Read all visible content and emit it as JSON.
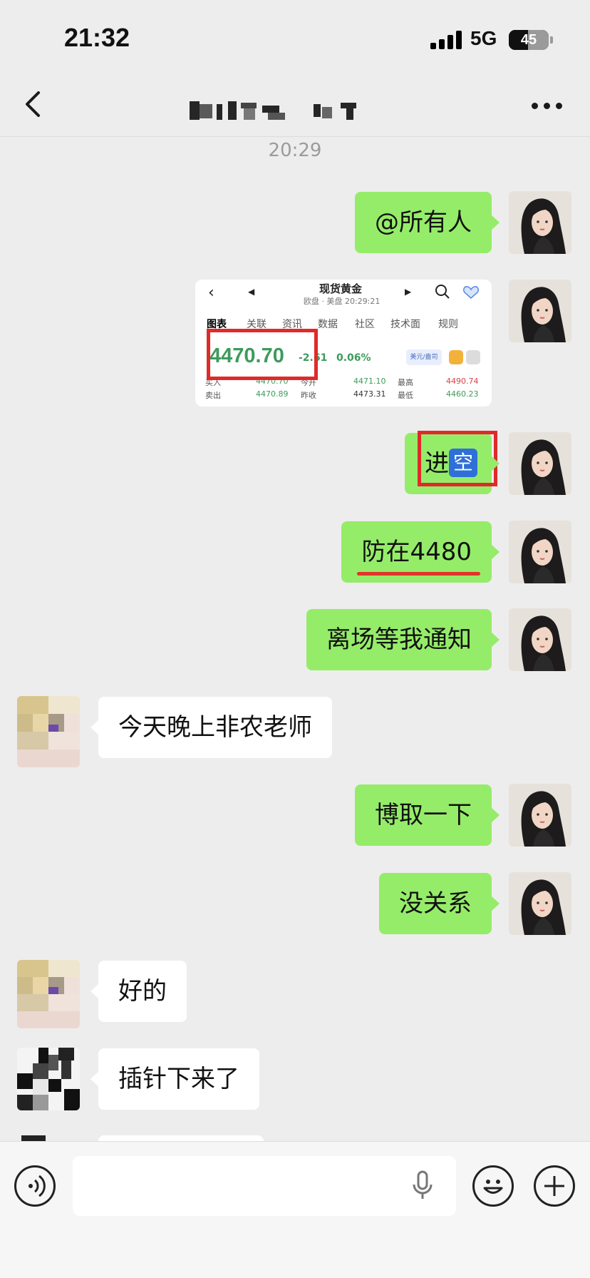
{
  "status": {
    "time": "21:32",
    "network": "5G",
    "battery": "45"
  },
  "chat": {
    "timestamp": "20:29"
  },
  "messages": {
    "m1": "@所有人",
    "m3_prefix": "进",
    "m3_emoji": "空",
    "m4": "防在4480",
    "m5": "离场等我通知",
    "m6": "今天晚上非农老师",
    "m7": "博取一下",
    "m8": "没关系",
    "m9": "好的",
    "m10": "插针下来了"
  },
  "shared_image": {
    "title": "现货黄金",
    "subtitle": "欧盘 · 美盘 20:29:21",
    "tabs": [
      "图表",
      "关联",
      "资讯",
      "数据",
      "社区",
      "技术面",
      "规则"
    ],
    "price": "4470.70",
    "change": "-2.61",
    "change_pct": "0.06%",
    "unit": "美元/盎司",
    "quote": {
      "buy_label": "买入",
      "buy": "4470.70",
      "sell_label": "卖出",
      "sell": "4470.89",
      "open_label": "今开",
      "open": "4471.10",
      "prev_label": "昨收",
      "prev": "4473.31",
      "high_label": "最高",
      "high": "4490.74",
      "low_label": "最低",
      "low": "4460.23"
    }
  },
  "colors": {
    "my_bubble": "#95ec69",
    "their_bubble": "#ffffff",
    "background": "#ededed",
    "highlight": "#e02a2a"
  }
}
